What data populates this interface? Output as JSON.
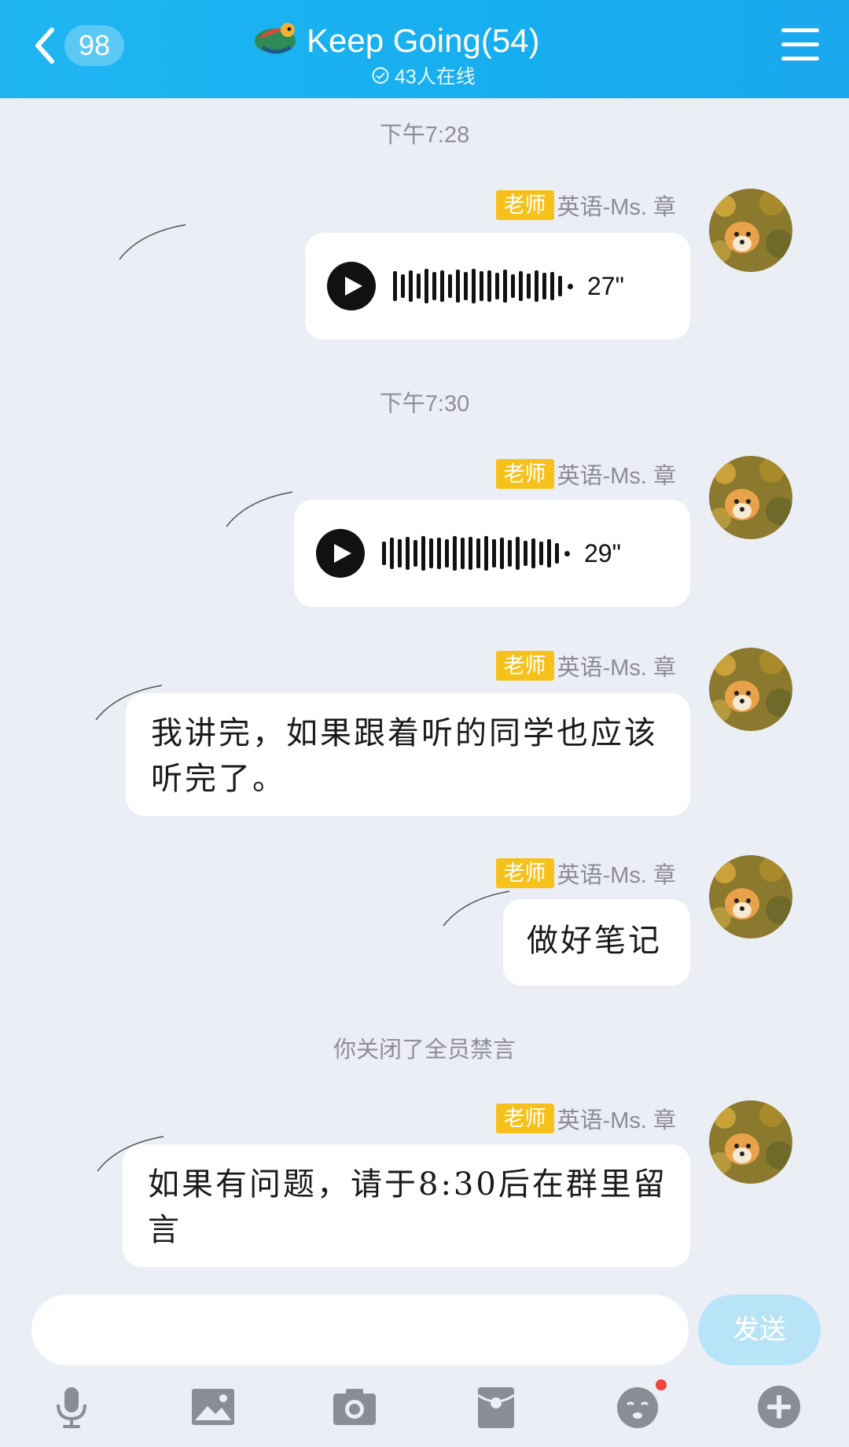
{
  "header": {
    "back_count": "98",
    "title": "Keep Going(54)",
    "online": "43人在线"
  },
  "messages": [
    {
      "time": "下午7:28",
      "role": "老师",
      "sender": "英语-Ms. 章",
      "type": "voice",
      "duration": "27\""
    },
    {
      "time": "下午7:30",
      "role": "老师",
      "sender": "英语-Ms. 章",
      "type": "voice",
      "duration": "29\""
    },
    {
      "role": "老师",
      "sender": "英语-Ms. 章",
      "type": "text",
      "text": "我讲完，如果跟着听的同学也应该听完了。"
    },
    {
      "role": "老师",
      "sender": "英语-Ms. 章",
      "type": "text",
      "text": "做好笔记"
    },
    {
      "system": "你关闭了全员禁言",
      "role": "老师",
      "sender": "英语-Ms. 章",
      "type": "text",
      "text": "如果有问题，请于8:30后在群里留言"
    }
  ],
  "input": {
    "placeholder": "",
    "send_label": "发送"
  },
  "toolbar": {
    "icons": [
      "microphone-icon",
      "image-icon",
      "camera-icon",
      "red-packet-icon",
      "emoji-icon",
      "plus-icon"
    ]
  },
  "colors": {
    "header": "#17aef0",
    "badge": "#f7c11c",
    "background": "#eceef6",
    "send_disabled": "#b9e4f8"
  }
}
